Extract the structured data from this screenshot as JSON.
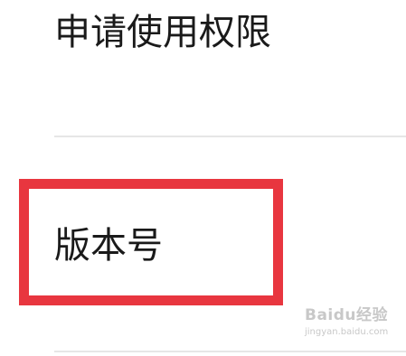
{
  "settings_list": {
    "items": [
      {
        "label": "申请使用权限"
      },
      {
        "label": "版本号"
      }
    ]
  },
  "annotation": {
    "highlight_color": "#e8363f",
    "highlighted_item": "版本号"
  },
  "watermark": {
    "brand_text": "Baidu经验",
    "url_text": "jingyan.baidu.com"
  }
}
